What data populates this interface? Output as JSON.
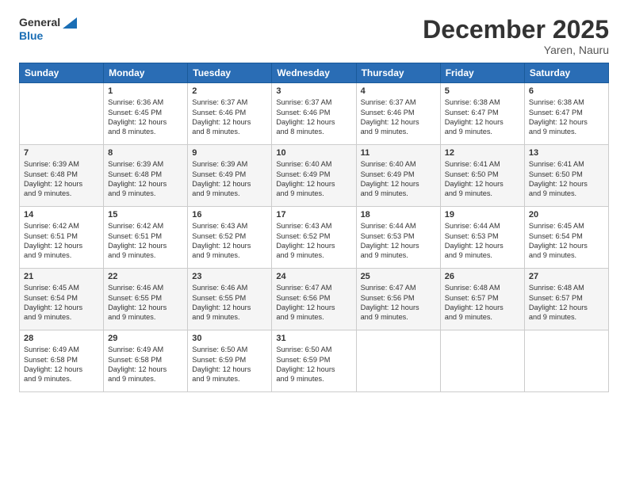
{
  "logo": {
    "line1": "General",
    "line2": "Blue"
  },
  "title": "December 2025",
  "location": "Yaren, Nauru",
  "header": {
    "days": [
      "Sunday",
      "Monday",
      "Tuesday",
      "Wednesday",
      "Thursday",
      "Friday",
      "Saturday"
    ]
  },
  "weeks": [
    [
      {
        "num": "",
        "info": ""
      },
      {
        "num": "1",
        "info": "Sunrise: 6:36 AM\nSunset: 6:45 PM\nDaylight: 12 hours\nand 8 minutes."
      },
      {
        "num": "2",
        "info": "Sunrise: 6:37 AM\nSunset: 6:46 PM\nDaylight: 12 hours\nand 8 minutes."
      },
      {
        "num": "3",
        "info": "Sunrise: 6:37 AM\nSunset: 6:46 PM\nDaylight: 12 hours\nand 8 minutes."
      },
      {
        "num": "4",
        "info": "Sunrise: 6:37 AM\nSunset: 6:46 PM\nDaylight: 12 hours\nand 9 minutes."
      },
      {
        "num": "5",
        "info": "Sunrise: 6:38 AM\nSunset: 6:47 PM\nDaylight: 12 hours\nand 9 minutes."
      },
      {
        "num": "6",
        "info": "Sunrise: 6:38 AM\nSunset: 6:47 PM\nDaylight: 12 hours\nand 9 minutes."
      }
    ],
    [
      {
        "num": "7",
        "info": "Sunrise: 6:39 AM\nSunset: 6:48 PM\nDaylight: 12 hours\nand 9 minutes."
      },
      {
        "num": "8",
        "info": "Sunrise: 6:39 AM\nSunset: 6:48 PM\nDaylight: 12 hours\nand 9 minutes."
      },
      {
        "num": "9",
        "info": "Sunrise: 6:39 AM\nSunset: 6:49 PM\nDaylight: 12 hours\nand 9 minutes."
      },
      {
        "num": "10",
        "info": "Sunrise: 6:40 AM\nSunset: 6:49 PM\nDaylight: 12 hours\nand 9 minutes."
      },
      {
        "num": "11",
        "info": "Sunrise: 6:40 AM\nSunset: 6:49 PM\nDaylight: 12 hours\nand 9 minutes."
      },
      {
        "num": "12",
        "info": "Sunrise: 6:41 AM\nSunset: 6:50 PM\nDaylight: 12 hours\nand 9 minutes."
      },
      {
        "num": "13",
        "info": "Sunrise: 6:41 AM\nSunset: 6:50 PM\nDaylight: 12 hours\nand 9 minutes."
      }
    ],
    [
      {
        "num": "14",
        "info": "Sunrise: 6:42 AM\nSunset: 6:51 PM\nDaylight: 12 hours\nand 9 minutes."
      },
      {
        "num": "15",
        "info": "Sunrise: 6:42 AM\nSunset: 6:51 PM\nDaylight: 12 hours\nand 9 minutes."
      },
      {
        "num": "16",
        "info": "Sunrise: 6:43 AM\nSunset: 6:52 PM\nDaylight: 12 hours\nand 9 minutes."
      },
      {
        "num": "17",
        "info": "Sunrise: 6:43 AM\nSunset: 6:52 PM\nDaylight: 12 hours\nand 9 minutes."
      },
      {
        "num": "18",
        "info": "Sunrise: 6:44 AM\nSunset: 6:53 PM\nDaylight: 12 hours\nand 9 minutes."
      },
      {
        "num": "19",
        "info": "Sunrise: 6:44 AM\nSunset: 6:53 PM\nDaylight: 12 hours\nand 9 minutes."
      },
      {
        "num": "20",
        "info": "Sunrise: 6:45 AM\nSunset: 6:54 PM\nDaylight: 12 hours\nand 9 minutes."
      }
    ],
    [
      {
        "num": "21",
        "info": "Sunrise: 6:45 AM\nSunset: 6:54 PM\nDaylight: 12 hours\nand 9 minutes."
      },
      {
        "num": "22",
        "info": "Sunrise: 6:46 AM\nSunset: 6:55 PM\nDaylight: 12 hours\nand 9 minutes."
      },
      {
        "num": "23",
        "info": "Sunrise: 6:46 AM\nSunset: 6:55 PM\nDaylight: 12 hours\nand 9 minutes."
      },
      {
        "num": "24",
        "info": "Sunrise: 6:47 AM\nSunset: 6:56 PM\nDaylight: 12 hours\nand 9 minutes."
      },
      {
        "num": "25",
        "info": "Sunrise: 6:47 AM\nSunset: 6:56 PM\nDaylight: 12 hours\nand 9 minutes."
      },
      {
        "num": "26",
        "info": "Sunrise: 6:48 AM\nSunset: 6:57 PM\nDaylight: 12 hours\nand 9 minutes."
      },
      {
        "num": "27",
        "info": "Sunrise: 6:48 AM\nSunset: 6:57 PM\nDaylight: 12 hours\nand 9 minutes."
      }
    ],
    [
      {
        "num": "28",
        "info": "Sunrise: 6:49 AM\nSunset: 6:58 PM\nDaylight: 12 hours\nand 9 minutes."
      },
      {
        "num": "29",
        "info": "Sunrise: 6:49 AM\nSunset: 6:58 PM\nDaylight: 12 hours\nand 9 minutes."
      },
      {
        "num": "30",
        "info": "Sunrise: 6:50 AM\nSunset: 6:59 PM\nDaylight: 12 hours\nand 9 minutes."
      },
      {
        "num": "31",
        "info": "Sunrise: 6:50 AM\nSunset: 6:59 PM\nDaylight: 12 hours\nand 9 minutes."
      },
      {
        "num": "",
        "info": ""
      },
      {
        "num": "",
        "info": ""
      },
      {
        "num": "",
        "info": ""
      }
    ]
  ]
}
